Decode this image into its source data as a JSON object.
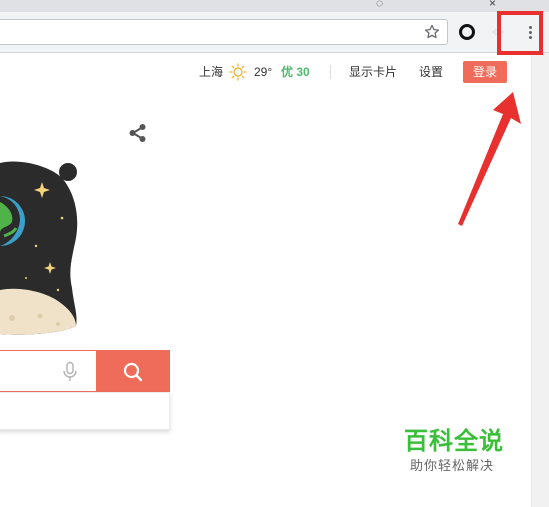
{
  "browser": {
    "window_controls": {
      "close_glyph": "×"
    },
    "address_bar": {
      "value": ""
    },
    "icons": [
      "star-icon",
      "circle-extension-icon",
      "faded-extension-icon",
      "menu-dots-icon"
    ]
  },
  "topbar": {
    "city": "上海",
    "weather_icon": "sun-icon",
    "temperature": "29°",
    "aqi": "优 30",
    "show_card": "显示卡片",
    "settings": "设置",
    "login": "登录"
  },
  "search": {
    "query": "",
    "mic_icon": "mic-icon",
    "button_icon": "search-icon"
  },
  "watermark": {
    "title": "百科全说",
    "subtitle": "助你轻松解决"
  },
  "colors": {
    "accent": "#f06c5a",
    "annotation": "#e8312f",
    "aqi_good": "#52b96e",
    "watermark_green": "#3bbf3b"
  }
}
